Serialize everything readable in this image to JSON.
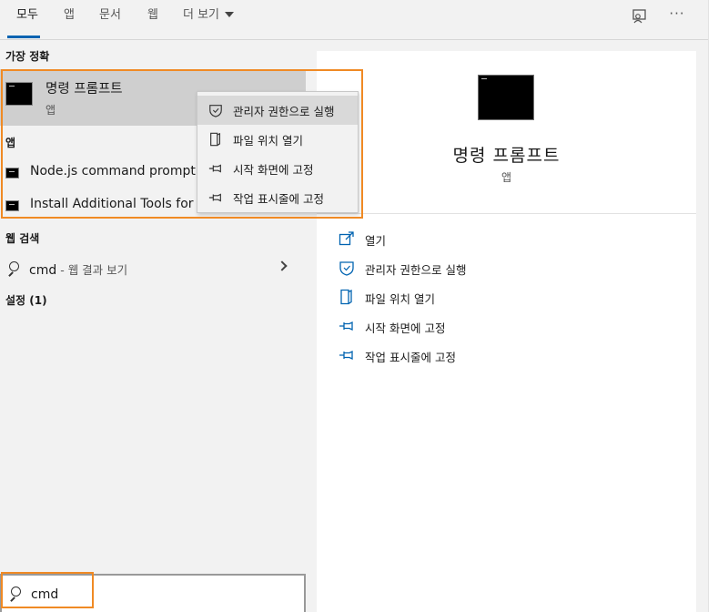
{
  "tabs": [
    {
      "label": "모두",
      "active": true
    },
    {
      "label": "앱"
    },
    {
      "label": "문서"
    },
    {
      "label": "웹"
    },
    {
      "label": "더 보기"
    }
  ],
  "top_icons": [
    "feedback-icon",
    "more-options-icon"
  ],
  "more_options_glyph": "···",
  "sections": {
    "best_match": "가장 정확",
    "apps": "앱",
    "web_search": "웹 검색",
    "settings": "설정 (1)"
  },
  "best_match": {
    "title": "명령 프롬프트",
    "subtitle": "앱"
  },
  "apps": [
    {
      "label": "Node.js command prompt"
    },
    {
      "label": "Install Additional Tools for Node.js"
    }
  ],
  "web_search": {
    "query": "cmd",
    "suffix": " - 웹 결과 보기"
  },
  "context_menu": [
    {
      "label": "관리자 권한으로 실행",
      "icon": "shield-icon",
      "highlighted": true
    },
    {
      "label": "파일 위치 열기",
      "icon": "file-location-icon"
    },
    {
      "label": "시작 화면에 고정",
      "icon": "pin-icon"
    },
    {
      "label": "작업 표시줄에 고정",
      "icon": "pin-icon"
    }
  ],
  "preview": {
    "title": "명령 프롬프트",
    "subtitle": "앱",
    "actions": [
      {
        "label": "열기",
        "icon": "open-icon"
      },
      {
        "label": "관리자 권한으로 실행",
        "icon": "shield-icon"
      },
      {
        "label": "파일 위치 열기",
        "icon": "file-location-icon"
      },
      {
        "label": "시작 화면에 고정",
        "icon": "pin-icon"
      },
      {
        "label": "작업 표시줄에 고정",
        "icon": "pin-icon"
      }
    ]
  },
  "search": {
    "value": "cmd"
  },
  "colors": {
    "accent": "#0063b1",
    "highlight_border": "#f08a24",
    "pane_background": "#f2f2f2"
  }
}
